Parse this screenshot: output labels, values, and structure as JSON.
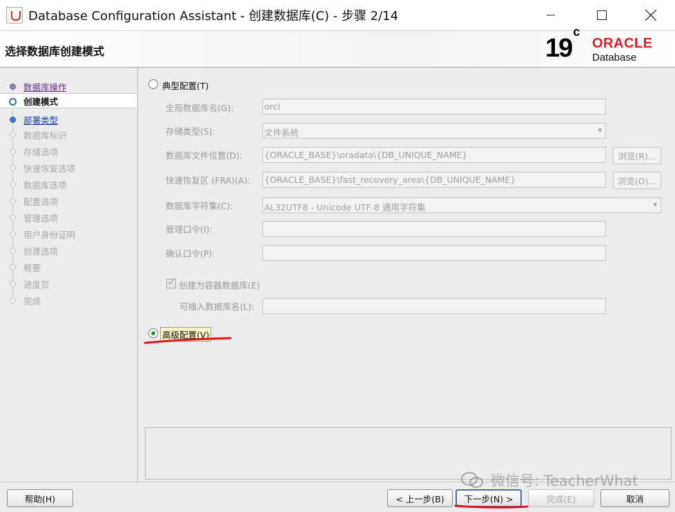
{
  "window": {
    "title": "Database Configuration Assistant - 创建数据库(C) - 步骤 2/14",
    "minimize_glyph": "—",
    "maximize_glyph": "☐",
    "close_glyph": "✕"
  },
  "header": {
    "step_title": "选择数据库创建模式",
    "logo_version": "19",
    "logo_version_sup": "c",
    "logo_brand": "ORACLE",
    "logo_product": "Database",
    "brand_color": "#e31b23"
  },
  "nav": {
    "items": [
      {
        "label": "数据库操作",
        "state": "done"
      },
      {
        "label": "创建模式",
        "state": "active"
      },
      {
        "label": "部署类型",
        "state": "link"
      },
      {
        "label": "数据库标识",
        "state": "disabled"
      },
      {
        "label": "存储选项",
        "state": "disabled"
      },
      {
        "label": "快速恢复选项",
        "state": "disabled"
      },
      {
        "label": "数据库选项",
        "state": "disabled"
      },
      {
        "label": "配置选项",
        "state": "disabled"
      },
      {
        "label": "管理选项",
        "state": "disabled"
      },
      {
        "label": "用户身份证明",
        "state": "disabled"
      },
      {
        "label": "创建选项",
        "state": "disabled"
      },
      {
        "label": "概要",
        "state": "disabled"
      },
      {
        "label": "进度页",
        "state": "disabled"
      },
      {
        "label": "完成",
        "state": "disabled"
      }
    ]
  },
  "main": {
    "typical": {
      "label": "典型配置(T)",
      "selected": false,
      "global_db_name": {
        "label": "全局数据库名(G):",
        "value": "orcl"
      },
      "storage_type": {
        "label": "存储类型(S):",
        "value": "文件系统"
      },
      "db_file_location": {
        "label": "数据库文件位置(D):",
        "value": "{ORACLE_BASE}\\oradata\\{DB_UNIQUE_NAME}",
        "browse": "浏览(R)..."
      },
      "fra": {
        "label": "快速恢复区 (FRA)(A):",
        "value": "{ORACLE_BASE}\\fast_recovery_area\\{DB_UNIQUE_NAME}",
        "browse": "浏览(O)..."
      },
      "charset": {
        "label": "数据库字符集(C):",
        "value": "AL32UTF8 - Unicode UTF-8 通用字符集"
      },
      "admin_password": {
        "label": "管理口令(I):",
        "value": ""
      },
      "confirm_password": {
        "label": "确认口令(P):",
        "value": ""
      },
      "container_db": {
        "label": "创建为容器数据库(E)",
        "checked": true
      },
      "pdb_name": {
        "label": "可插入数据库名(L):",
        "value": ""
      }
    },
    "advanced": {
      "label": "高级配置(V)",
      "selected": true
    }
  },
  "buttons": {
    "help": "帮助(H)",
    "back": "< 上一步(B)",
    "next": "下一步(N) >",
    "finish": "完成(E)",
    "cancel": "取消"
  },
  "watermark": {
    "text": "微信号: TeacherWhat"
  },
  "annotation_color": "#e0141e"
}
